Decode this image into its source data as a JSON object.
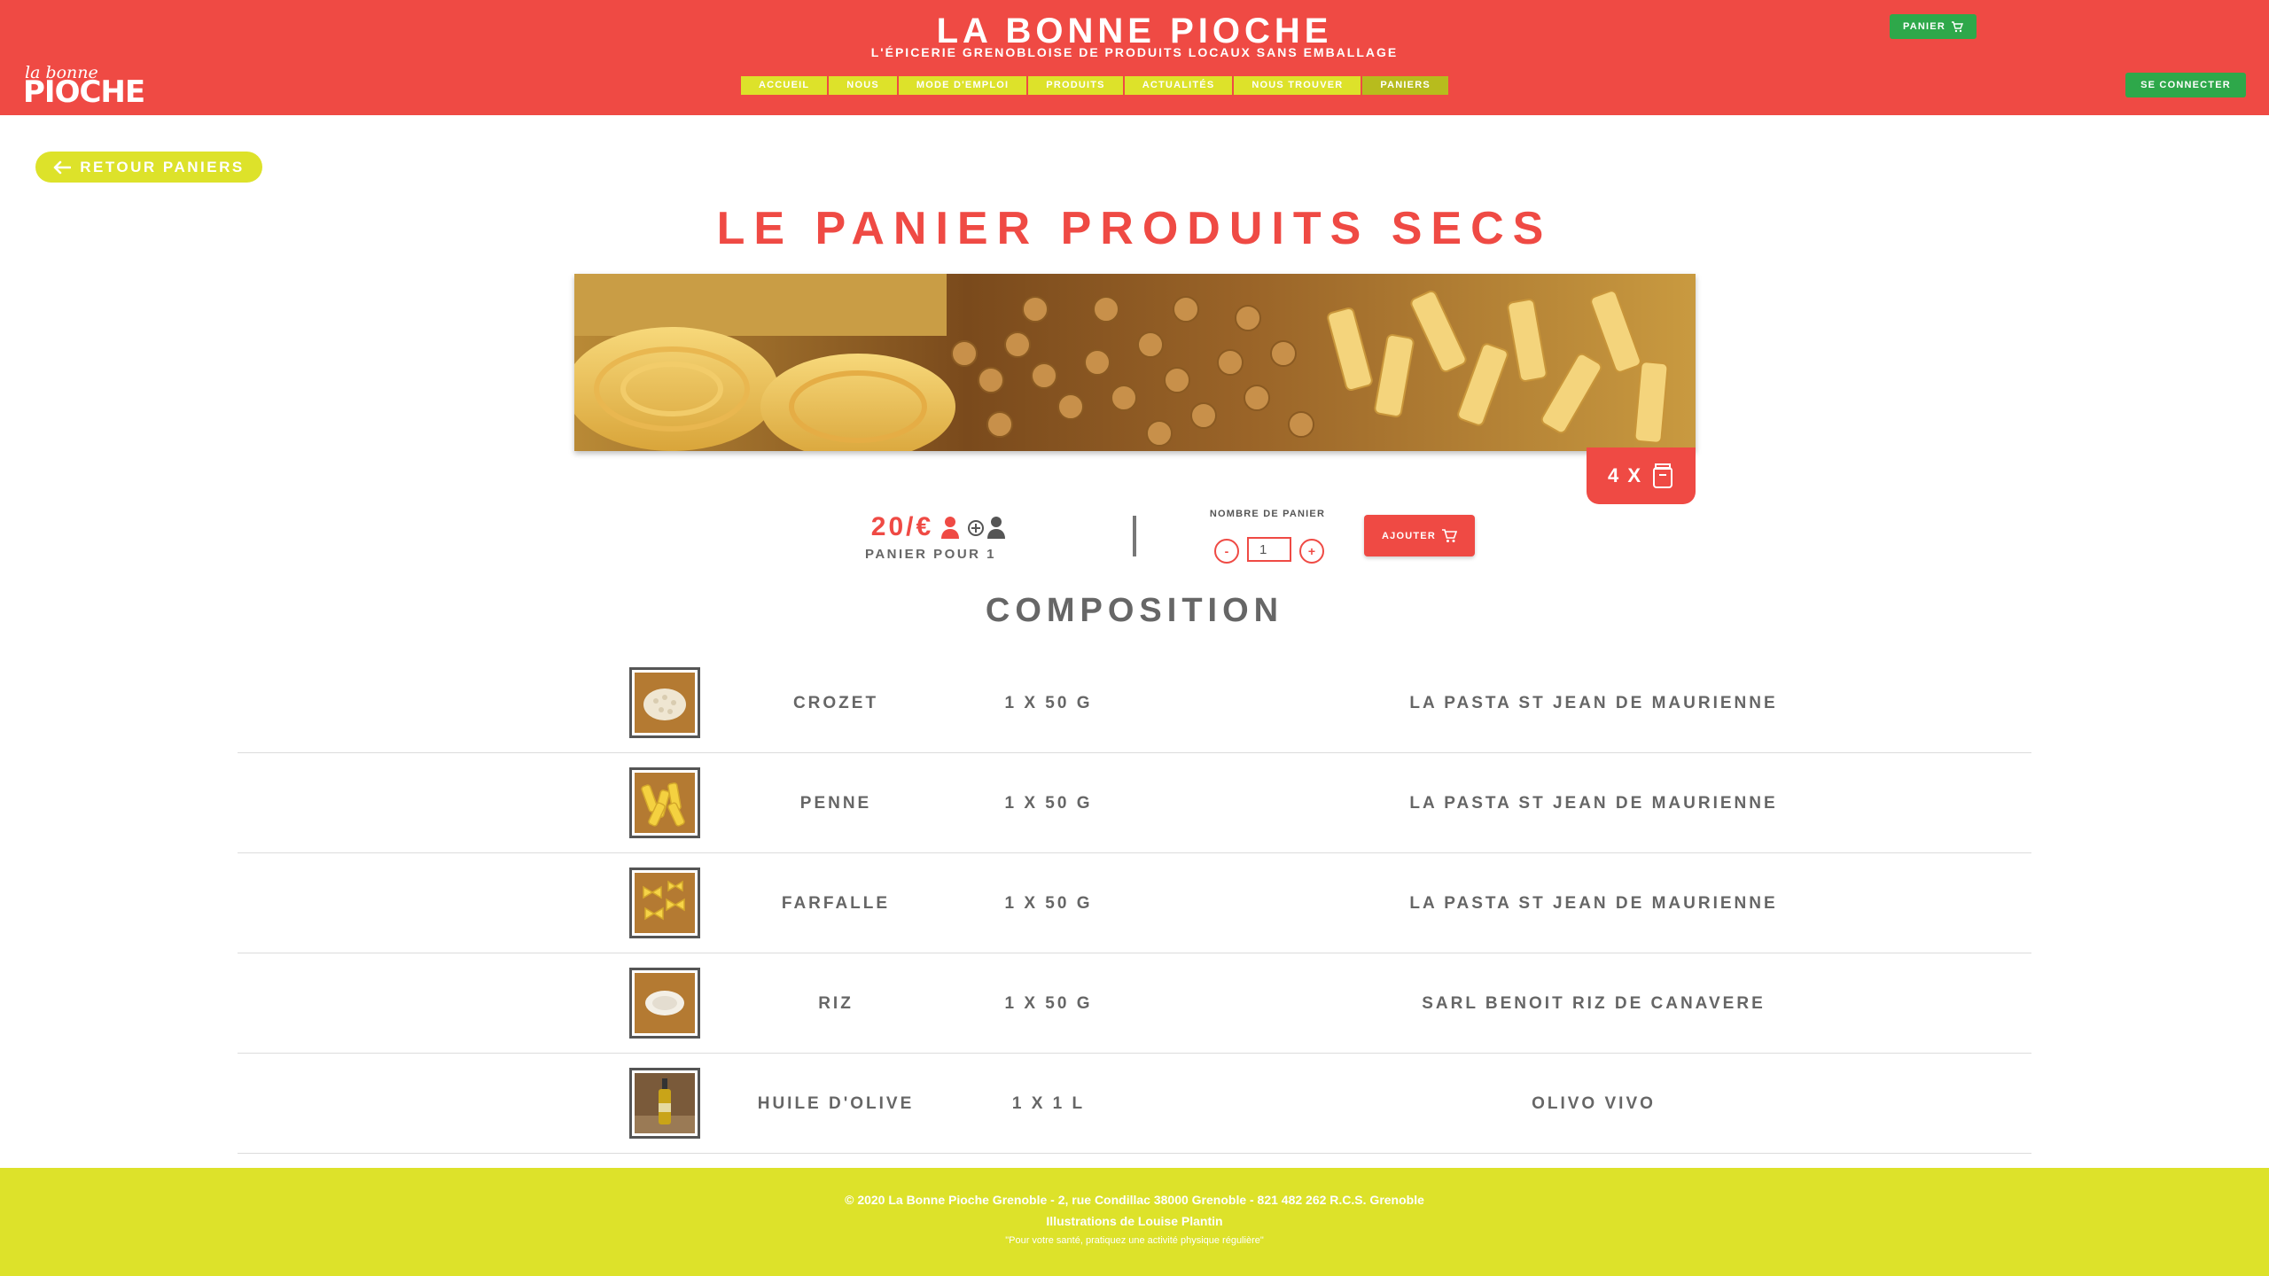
{
  "header": {
    "title": "LA BONNE PIOCHE",
    "subtitle": "L'ÉPICERIE GRENOBLOISE DE PRODUITS LOCAUX SANS EMBALLAGE",
    "logo_small": "la bonne",
    "logo_big": "PIOCHE",
    "cart_label": "PANIER",
    "login_label": "SE CONNECTER",
    "nav": [
      {
        "label": "ACCUEIL"
      },
      {
        "label": "NOUS"
      },
      {
        "label": "MODE D'EMPLOI"
      },
      {
        "label": "PRODUITS"
      },
      {
        "label": "ACTUALITÉS"
      },
      {
        "label": "NOUS TROUVER"
      },
      {
        "label": "PANIERS",
        "active": true
      }
    ]
  },
  "back_label": "RETOUR PANIERS",
  "page_title": "LE PANIER PRODUITS SECS",
  "badge": {
    "text": "4 X",
    "icon": "jar-icon"
  },
  "price": {
    "value": "20/€",
    "subtitle": "PANIER POUR 1",
    "icons": [
      "person-icon",
      "add-person-icon"
    ]
  },
  "order": {
    "label": "NOMBRE DE PANIER",
    "minus": "-",
    "plus": "+",
    "quantity": "1",
    "add_label": "AJOUTER"
  },
  "composition_title": "COMPOSITION",
  "items": [
    {
      "name": "CROZET",
      "qty": "1 X 50 G",
      "producer": "LA PASTA ST JEAN DE MAURIENNE",
      "thumb": "crozet-thumbnail"
    },
    {
      "name": "PENNE",
      "qty": "1 X 50 G",
      "producer": "LA PASTA ST JEAN DE MAURIENNE",
      "thumb": "penne-thumbnail"
    },
    {
      "name": "FARFALLE",
      "qty": "1 X 50 G",
      "producer": "LA PASTA ST JEAN DE MAURIENNE",
      "thumb": "farfalle-thumbnail"
    },
    {
      "name": "RIZ",
      "qty": "1 X 50 G",
      "producer": "SARL BENOIT RIZ DE CANAVERE",
      "thumb": "riz-thumbnail"
    },
    {
      "name": "HUILE D'OLIVE",
      "qty": "1 X 1 L",
      "producer": "OLIVO VIVO",
      "thumb": "olive-oil-thumbnail"
    }
  ],
  "footer": {
    "line1": "© 2020 La Bonne Pioche Grenoble - 2, rue Condillac 38000 Grenoble - 821 482 262 R.C.S. Grenoble",
    "line2": "Illustrations de Louise Plantin",
    "line3": "\"Pour votre santé, pratiquez une activité physique régulière\""
  },
  "colors": {
    "primary_red": "#ef4a44",
    "lime": "#dde22a",
    "green": "#2ea84a",
    "text_gray": "#666666"
  }
}
